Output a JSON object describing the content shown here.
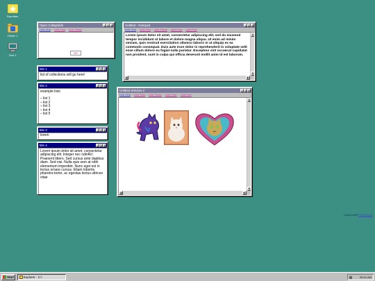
{
  "desktop": {
    "icons": [
      {
        "label": "Favorites",
        "icon": "star-icon"
      },
      {
        "label": "Folder 1",
        "icon": "folder-icon"
      },
      {
        "label": "Test 1",
        "icon": "computer-icon"
      }
    ],
    "credit": {
      "prefix": "Layout credit",
      "link": "PoolEmbedd"
    }
  },
  "windows": {
    "collapsible": {
      "title": "Open Collapsible",
      "menu": [
        "Link One",
        "Link Two",
        "Link Three"
      ],
      "ok_label": "OK"
    },
    "notepad": {
      "title": "Untitled - Notepad",
      "menu": [
        "Link One",
        "Link Two",
        "Link Three",
        "Link Four",
        "Link Five"
      ],
      "body": "Lorem ipsum dolor sit amet, consectetur adipiscing elit, sed do eiusmod tempor incididunt ut labore et dolore magna aliqua. Ut enim ad minim veniam, quis nostrud exercitation ullamco laboris ni ut aliquip ex ea commodo consequat. Duis aute irure dolor in reprehenderit in voluptate velit esse cillum dolore eu fugiat nulla pariatur. Excepteur sint occaecat cupidatat non proident, sunt in culpa qui officia deserunt mollit anim id est laborum."
    },
    "title1": {
      "title": "title 1",
      "body": "list of collections will go here!"
    },
    "title2": {
      "title": "title 2",
      "heading": "example lists",
      "items": [
        "– list 1",
        "– list 2",
        "– list 3",
        "– list 4",
        "– list 5"
      ]
    },
    "title3": {
      "title": "title 3",
      "body": "lorem"
    },
    "title4": {
      "title": "title 4",
      "body": "Lorem ipsum dolor sit amet, consectetur adipiscing elit. Integer nec odioRo'. Praesent libero. Sed cursus ante dapibus diam. Sed nisi. Nulla quis sem at nibh elementum imperdiet. Nunc eget est in lectus ornare cursus. Etiam lobortis pharetra tortor, ac egestas lectus ultrices vitae"
    },
    "window2": {
      "title": "Untitled Window 2",
      "menu": [
        "Link One",
        "Link Two",
        "Link Three",
        "Link Four",
        "Link Five"
      ],
      "images": [
        "cat-sticker-image",
        "kitten-photo-image",
        "heart-cat-image"
      ]
    }
  },
  "taskbar": {
    "start_label": "Start",
    "task_label": "Explorer - C:\\",
    "clock": "05:41 AM"
  }
}
